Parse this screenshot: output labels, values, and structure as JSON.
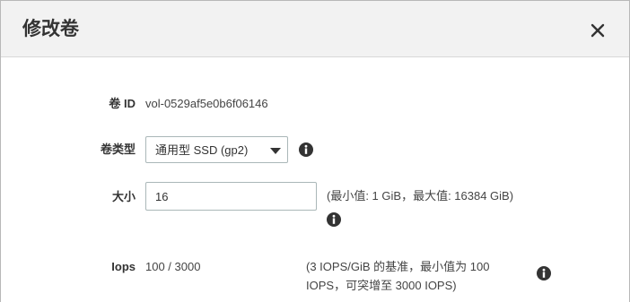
{
  "dialog": {
    "title": "修改卷",
    "close_icon": "close-icon"
  },
  "volume_id": {
    "label": "卷 ID",
    "value": "vol-0529af5e0b6f06146"
  },
  "volume_type": {
    "label": "卷类型",
    "selected": "通用型 SSD (gp2)",
    "info_icon": "info-icon"
  },
  "size": {
    "label": "大小",
    "value": "16",
    "hint": "(最小值: 1 GiB，最大值: 16384 GiB)",
    "info_icon": "info-icon"
  },
  "iops": {
    "label": "Iops",
    "value": "100 / 3000",
    "hint_line1": "(3 IOPS/GiB 的基准，最小值为 100",
    "hint_line2": "IOPS，可突增至 3000 IOPS)",
    "info_icon": "info-icon"
  }
}
